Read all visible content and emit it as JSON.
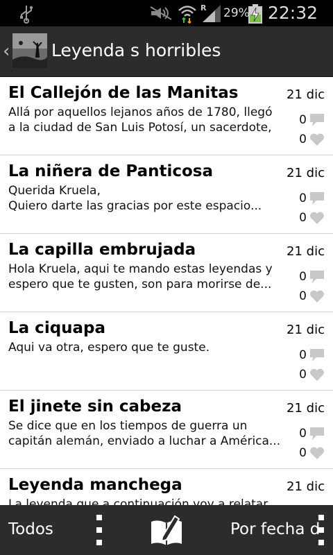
{
  "status_bar": {
    "battery_percent": "29%",
    "time": "22:32",
    "icons": [
      "usb-icon",
      "mute-icon",
      "wifi-icon",
      "signal-icon",
      "battery-charging-icon"
    ]
  },
  "action_bar": {
    "title": "Leyenda s horribles",
    "back_icon": "chevron-left-icon"
  },
  "items": [
    {
      "title": "El Callejón de las Manitas",
      "date": "21 dic",
      "excerpt": "Allá por aquellos lejanos años de 1780, llegó a la ciudad de San Luis Potosí, un sacerdote, q...",
      "comments": "0",
      "likes": "0"
    },
    {
      "title": "La niñera de Panticosa",
      "date": "21 dic",
      "excerpt": "Querida Kruela,\n Quiero darte las gracias por este espacio...",
      "comments": "0",
      "likes": "0"
    },
    {
      "title": "La capilla embrujada",
      "date": "21 dic",
      "excerpt": "Hola Kruela, aqui te mando estas leyendas y espero que te gusten, son para morirse de...",
      "comments": "0",
      "likes": "0"
    },
    {
      "title": "La ciquapa",
      "date": "21 dic",
      "excerpt": "Aqui va otra, espero que te guste.",
      "comments": "0",
      "likes": "0"
    },
    {
      "title": "El jinete sin cabeza",
      "date": "21 dic",
      "excerpt": "Se dice que en los tiempos de guerra un capitán alemán, enviado a luchar a América...",
      "comments": "0",
      "likes": "0"
    },
    {
      "title": "Leyenda manchega",
      "date": "21 dic",
      "excerpt": "La leyenda que a continuación voy a relatar...",
      "comments": "",
      "likes": ""
    }
  ],
  "bottom_bar": {
    "filter_label": "Todos",
    "sort_label": "Por fecha d...",
    "compose_icon": "compose-book-icon"
  }
}
